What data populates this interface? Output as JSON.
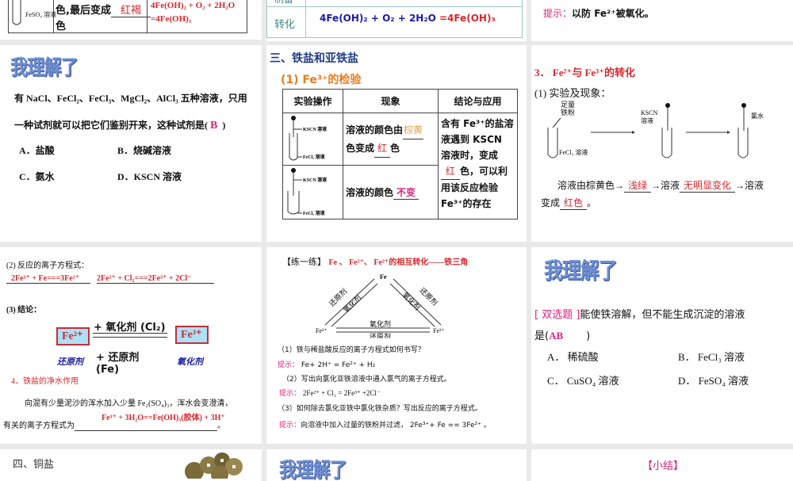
{
  "s1": {
    "text1": "色,最后变成",
    "blank": "红褐",
    "text2": "色",
    "tube": "FeSO₄ 溶液",
    "eq1": "4Fe(OH)₂ + O₂ + 2H₂O",
    "eq2": "=4Fe(OH)₃"
  },
  "s2": {
    "row_top": "制备",
    "row_label": "转化",
    "eq_a": "4Fe(OH)₂ + O₂ + 2H₂O",
    "eq_b": "=4Fe(OH)₃"
  },
  "s3": {
    "hint_label": "提示：",
    "hint": "以防 Fe²⁺被氧化。"
  },
  "s4": {
    "title": "我理解了",
    "q1": "有 NaCl、FeCl₂、FeCl₃、MgCl₂、AlCl₃ 五种溶液，只用",
    "q2": "一种试剂就可以把它们鉴别开来，这种试剂是(",
    "answer": "B",
    "q_end": ")",
    "options": [
      "A．盐酸",
      "B．烧碱溶液",
      "C．氨水",
      "D．KSCN 溶液"
    ]
  },
  "s5": {
    "title": "三、铁盐和亚铁盐",
    "subtitle": "(1) Fe³⁺的检验",
    "headers": [
      "实验操作",
      "现象",
      "结论与应用"
    ],
    "tube_top": "KSCN 溶液",
    "tube1": "FeCl₃ 溶液",
    "tube2": "FeCl₂ 溶液",
    "r1a": "溶液的颜色由",
    "r1b": "棕黄",
    "r1c": "色变成",
    "r1d": "红",
    "r1e": "色",
    "r2a": "溶液的颜色",
    "r2b": "不变",
    "c1": "含有 Fe³⁺的盐溶液遇到 KSCN 溶液时，变成",
    "c_blank": "红",
    "c2": "色，可以利用该反应检验 Fe³⁺的存在"
  },
  "s6": {
    "title": "3． Fe²⁺与 Fe³⁺的转化",
    "sub": "(1) 实验及现象：",
    "l_iron": "足量铁粉",
    "l_fecl3": "FeCl₃ 溶液",
    "l_kscn": "KSCN溶液",
    "l_cl": "氯水",
    "t1": "溶液由棕黄色→",
    "b1": "浅绿",
    "t2": "→溶液",
    "b2": "无明显变化",
    "t3": "→溶液",
    "t4": "变成",
    "b3": "红色",
    "t5": "。"
  },
  "s7": {
    "h1": "(2) 反应的离子方程式：",
    "eq1": "2Fe³⁺ + Fe===3Fe²⁺",
    "eq2": "2Fe²⁺ + Cl₂===2Fe³⁺ + 2Cl⁻",
    "h2": "(3) 结论：",
    "fe2": "Fe²⁺",
    "fe3": "Fe³⁺",
    "ox": "+ 氧化剂 (Cl₂)",
    "red": "+ 还原剂 (Fe)",
    "lbl_red": "还原剂",
    "lbl_ox": "氧化剂",
    "h3": "4．铁盐的净水作用",
    "p1": "向混有少量泥沙的浑水加入少量 Fe₂(SO₄)₃，浑水会变澄清，",
    "p2": "有关的离子方程式为",
    "eq3": "Fe³⁺ + 3H₂O==Fe(OH)₃(胶体) + 3H⁺",
    "end": "。"
  },
  "s8": {
    "tag": "【练一练】",
    "title": "Fe 、 Fe²⁺、 Fe³⁺的相互转化——铁三角",
    "fe": "Fe",
    "fe2": "Fe²⁺",
    "fe3": "Fe³⁺",
    "ox": "氧化剂",
    "red": "还原剂",
    "q1": "（1）铁与稀盐酸反应的离子方程式如何书写？",
    "a1": "Fe+ 2H⁺ = Fe²⁺ + H₂",
    "q2": "（2）写出向氯化亚铁溶液中通入氯气的离子方程式。",
    "a2": "2Fe²⁺ + Cl₂ = 2Fe³⁺ +2Cl⁻",
    "q3": "（3）如何除去氯化亚铁中氯化铁杂质？写出反应的离子方程式。",
    "a3": "向溶液中加入过量的铁粉并过滤， 2Fe³⁺+ Fe == 3Fe²⁺ 。",
    "hint": "提示："
  },
  "s9": {
    "title": "我理解了",
    "tag": "[ 双选题 ]",
    "q1": "能使铁溶解，但不能生成沉淀的溶液",
    "q2": "是(",
    "answer": "AB",
    "q_end": ")",
    "options": [
      "A． 稀硫酸",
      "B． FeCl₃ 溶液",
      "C． CuSO₄ 溶液",
      "D． FeSO₄ 溶液"
    ]
  },
  "s10": {
    "title": "四、铜盐"
  },
  "s11": {
    "title": "我理解了"
  },
  "s12": {
    "title": "【小结】"
  }
}
